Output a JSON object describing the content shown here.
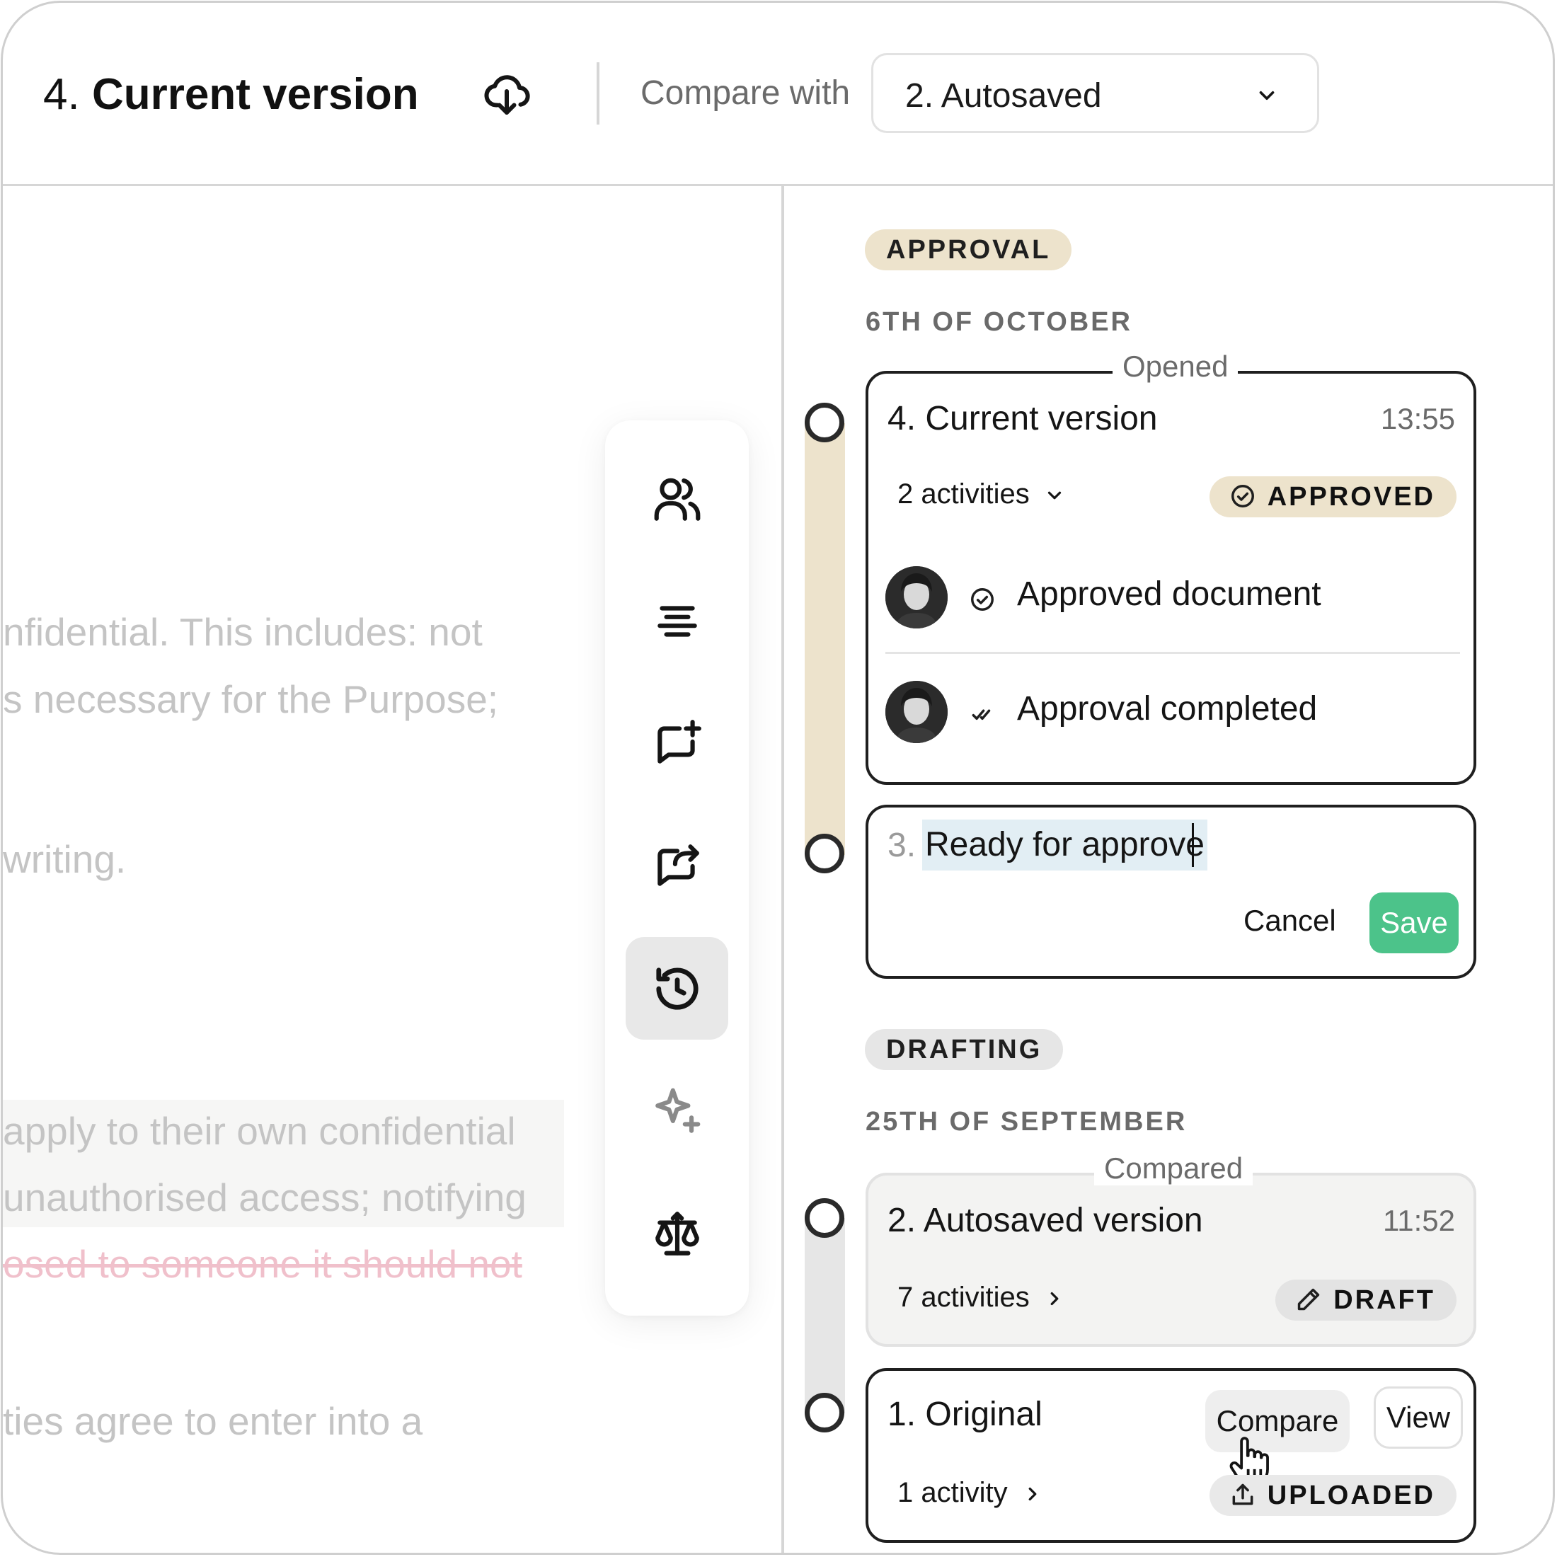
{
  "header": {
    "title_number": "4.",
    "title_name": "Current version",
    "compare_label": "Compare with",
    "compare_selected": "2. Autosaved"
  },
  "document": {
    "lines": [
      "nfidential. This includes: not",
      "s necessary for the Purpose;",
      "writing.",
      "apply to their own confidential",
      " unauthorised access; notifying",
      "osed to someone it should not",
      "ties agree to enter into a"
    ]
  },
  "toolbar": {
    "items": [
      "users-icon",
      "align-center-icon",
      "comment-add-icon",
      "comment-share-icon",
      "history-icon",
      "sparkle-icon",
      "scales-icon"
    ],
    "active": "history-icon"
  },
  "timeline": {
    "approval": {
      "stage": "APPROVAL",
      "date": "6TH OF OCTOBER",
      "current": {
        "tag": "Opened",
        "title": "4. Current version",
        "time": "13:55",
        "activities": "2 activities",
        "badge": "APPROVED",
        "items": [
          {
            "text": "Approved document",
            "icon": "check-circle-icon"
          },
          {
            "text": "Approval completed",
            "icon": "double-check-icon"
          }
        ]
      },
      "editing": {
        "number": "3.",
        "value": "Ready for approve",
        "cancel": "Cancel",
        "save": "Save"
      }
    },
    "drafting": {
      "stage": "DRAFTING",
      "date": "25TH OF SEPTEMBER",
      "autosaved": {
        "tag": "Compared",
        "title": "2. Autosaved version",
        "time": "11:52",
        "activities": "7 activities",
        "badge": "DRAFT"
      },
      "original": {
        "title": "1. Original",
        "compare": "Compare",
        "view": "View",
        "activities": "1 activity",
        "badge": "UPLOADED"
      }
    }
  },
  "colors": {
    "approval_beige": "#ede3cc",
    "save_green": "#4cc38a",
    "selection_blue": "#e2eef4",
    "struck_pink": "#f0c0cb"
  }
}
